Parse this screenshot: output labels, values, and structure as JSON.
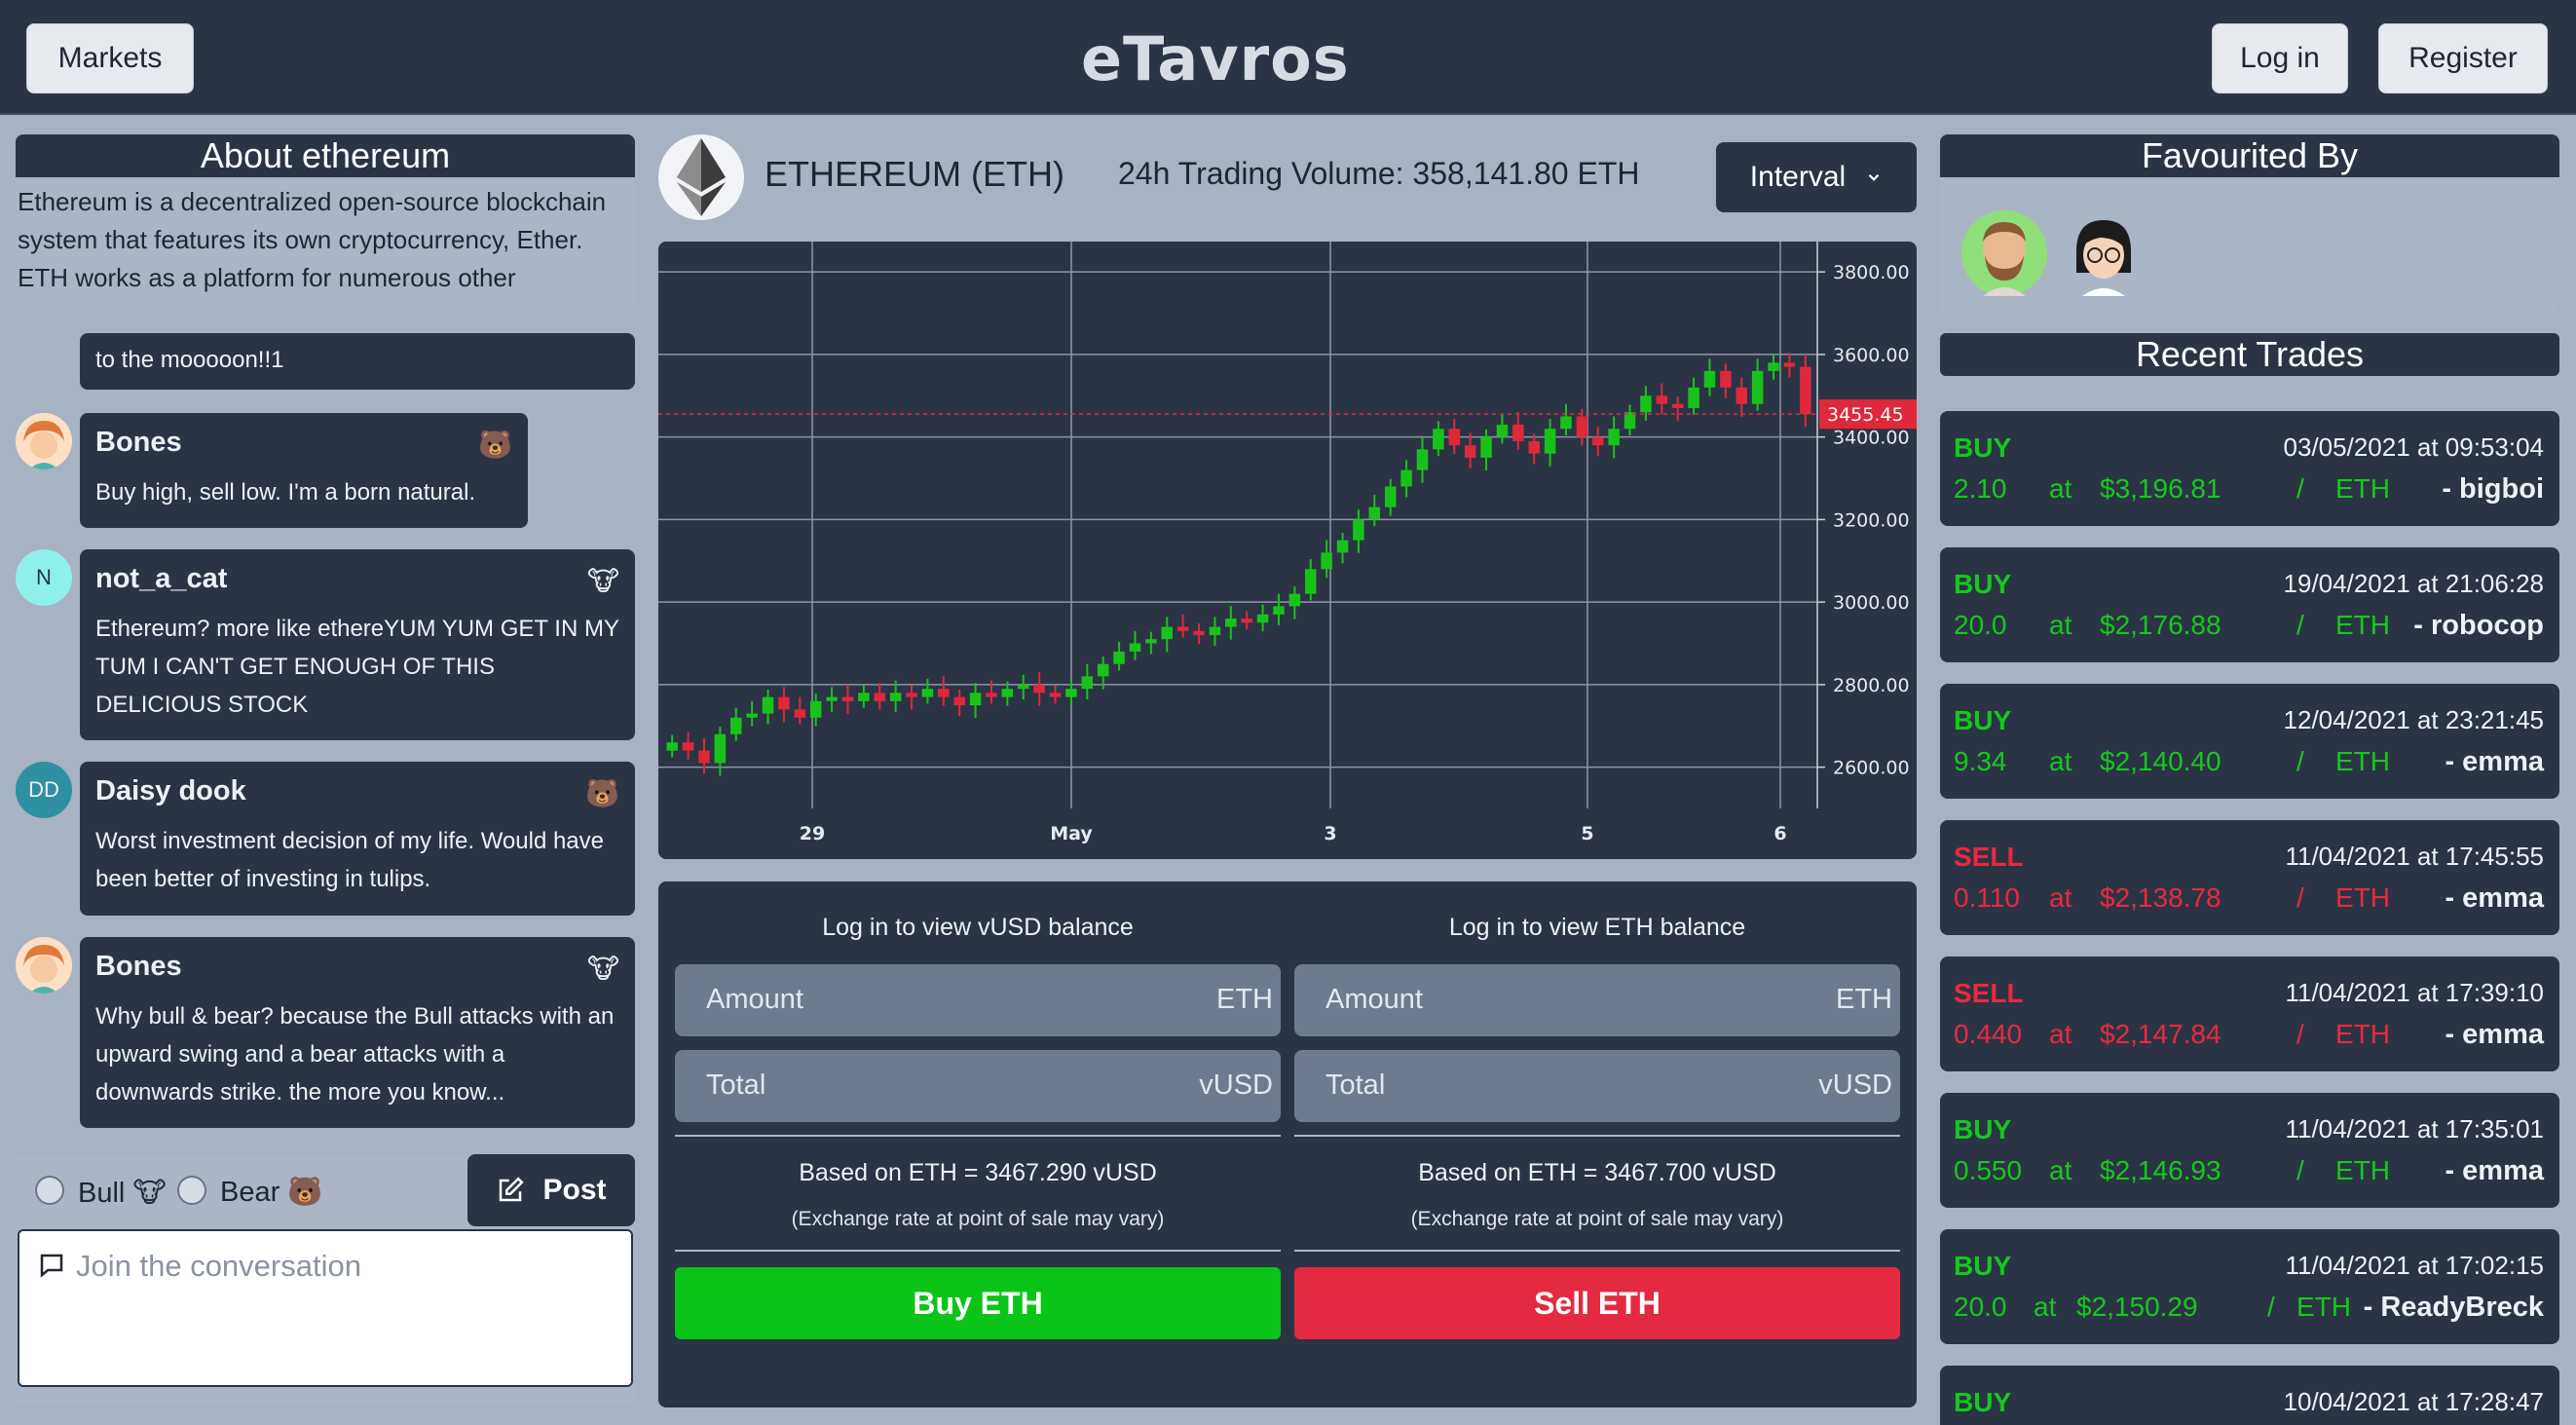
{
  "header": {
    "markets_label": "Markets",
    "brand": "eTavros",
    "login_label": "Log in",
    "register_label": "Register"
  },
  "about": {
    "title": "About ethereum",
    "text": "Ethereum is a decentralized open-source blockchain system that features its own cryptocurrency, Ether. ETH works as a platform for numerous other"
  },
  "chat": {
    "messages": [
      {
        "name": "",
        "text": "to the mooooon!!1",
        "tag": ""
      },
      {
        "name": "Bones",
        "text": "Buy high, sell low. I'm a born natural.",
        "tag": "🐻"
      },
      {
        "name": "not_a_cat",
        "initials": "N",
        "text": "Ethereum? more like ethereYUM YUM GET IN MY TUM I CAN'T GET ENOUGH OF THIS DELICIOUS STOCK",
        "tag": "🐮"
      },
      {
        "name": "Daisy dook",
        "initials": "DD",
        "text": "Worst investment decision of my life. Would have been better of investing in tulips.",
        "tag": "🐻"
      },
      {
        "name": "Bones",
        "text": "Why bull & bear? because the Bull attacks with an upward swing and a bear attacks with a downwards strike. the more you know...",
        "tag": "🐮"
      }
    ],
    "bull_label": "Bull 🐮",
    "bear_label": "Bear 🐻",
    "post_label": "Post",
    "placeholder": "Join the conversation"
  },
  "asset": {
    "title": "ETHEREUM (ETH)",
    "volume": "24h Trading Volume: 358,141.80 ETH",
    "interval_label": "Interval"
  },
  "chart_data": {
    "type": "candlestick",
    "title": "",
    "x_labels": [
      "29",
      "May",
      "3",
      "5",
      "6"
    ],
    "y_ticks": [
      2600,
      2800,
      3000,
      3200,
      3400,
      3600,
      3800
    ],
    "ylim": [
      2500,
      3850
    ],
    "last_price": 3455.45,
    "last_price_label": "3455.45",
    "colors": {
      "up": "#19c21b",
      "down": "#e0283b",
      "grid": "#8d96a5"
    },
    "close_series": [
      2660,
      2640,
      2610,
      2680,
      2720,
      2730,
      2770,
      2740,
      2720,
      2760,
      2770,
      2760,
      2780,
      2760,
      2780,
      2770,
      2790,
      2770,
      2750,
      2780,
      2770,
      2790,
      2800,
      2780,
      2770,
      2790,
      2820,
      2850,
      2880,
      2900,
      2910,
      2940,
      2930,
      2920,
      2940,
      2960,
      2950,
      2970,
      2990,
      3020,
      3080,
      3120,
      3150,
      3200,
      3230,
      3280,
      3320,
      3370,
      3420,
      3380,
      3350,
      3400,
      3430,
      3390,
      3360,
      3420,
      3450,
      3400,
      3380,
      3420,
      3460,
      3500,
      3480,
      3470,
      3520,
      3560,
      3520,
      3480,
      3560,
      3580,
      3570,
      3455
    ]
  },
  "trade": {
    "buy": {
      "balance": "Log in to view vUSD balance",
      "amount_ph": "Amount",
      "amount_unit": "ETH",
      "total_ph": "Total",
      "total_unit": "vUSD",
      "rate": "Based on ETH = 3467.290 vUSD",
      "note": "(Exchange rate at point of sale may vary)",
      "button": "Buy ETH"
    },
    "sell": {
      "balance": "Log in to view ETH balance",
      "amount_ph": "Amount",
      "amount_unit": "ETH",
      "total_ph": "Total",
      "total_unit": "vUSD",
      "rate": "Based on ETH = 3467.700 vUSD",
      "note": "(Exchange rate at point of sale may vary)",
      "button": "Sell ETH"
    }
  },
  "favourited": {
    "title": "Favourited By"
  },
  "recent_trades": {
    "title": "Recent Trades",
    "items": [
      {
        "side": "BUY",
        "date": "03/05/2021 at 09:53:04",
        "qty": "2.10",
        "price": "$3,196.81",
        "unit": "ETH",
        "user": "- bigboi"
      },
      {
        "side": "BUY",
        "date": "19/04/2021 at 21:06:28",
        "qty": "20.0",
        "price": "$2,176.88",
        "unit": "ETH",
        "user": "- robocop"
      },
      {
        "side": "BUY",
        "date": "12/04/2021 at 23:21:45",
        "qty": "9.34",
        "price": "$2,140.40",
        "unit": "ETH",
        "user": "- emma"
      },
      {
        "side": "SELL",
        "date": "11/04/2021 at 17:45:55",
        "qty": "0.110",
        "price": "$2,138.78",
        "unit": "ETH",
        "user": "- emma"
      },
      {
        "side": "SELL",
        "date": "11/04/2021 at 17:39:10",
        "qty": "0.440",
        "price": "$2,147.84",
        "unit": "ETH",
        "user": "- emma"
      },
      {
        "side": "BUY",
        "date": "11/04/2021 at 17:35:01",
        "qty": "0.550",
        "price": "$2,146.93",
        "unit": "ETH",
        "user": "- emma"
      },
      {
        "side": "BUY",
        "date": "11/04/2021 at 17:02:15",
        "qty": "20.0",
        "price": "$2,150.29",
        "unit": "ETH",
        "user": "- ReadyBreck"
      },
      {
        "side": "BUY",
        "date": "10/04/2021 at 17:28:47",
        "qty": "",
        "price": "",
        "unit": "",
        "user": ""
      }
    ],
    "at_word": "at",
    "slash": "/"
  }
}
